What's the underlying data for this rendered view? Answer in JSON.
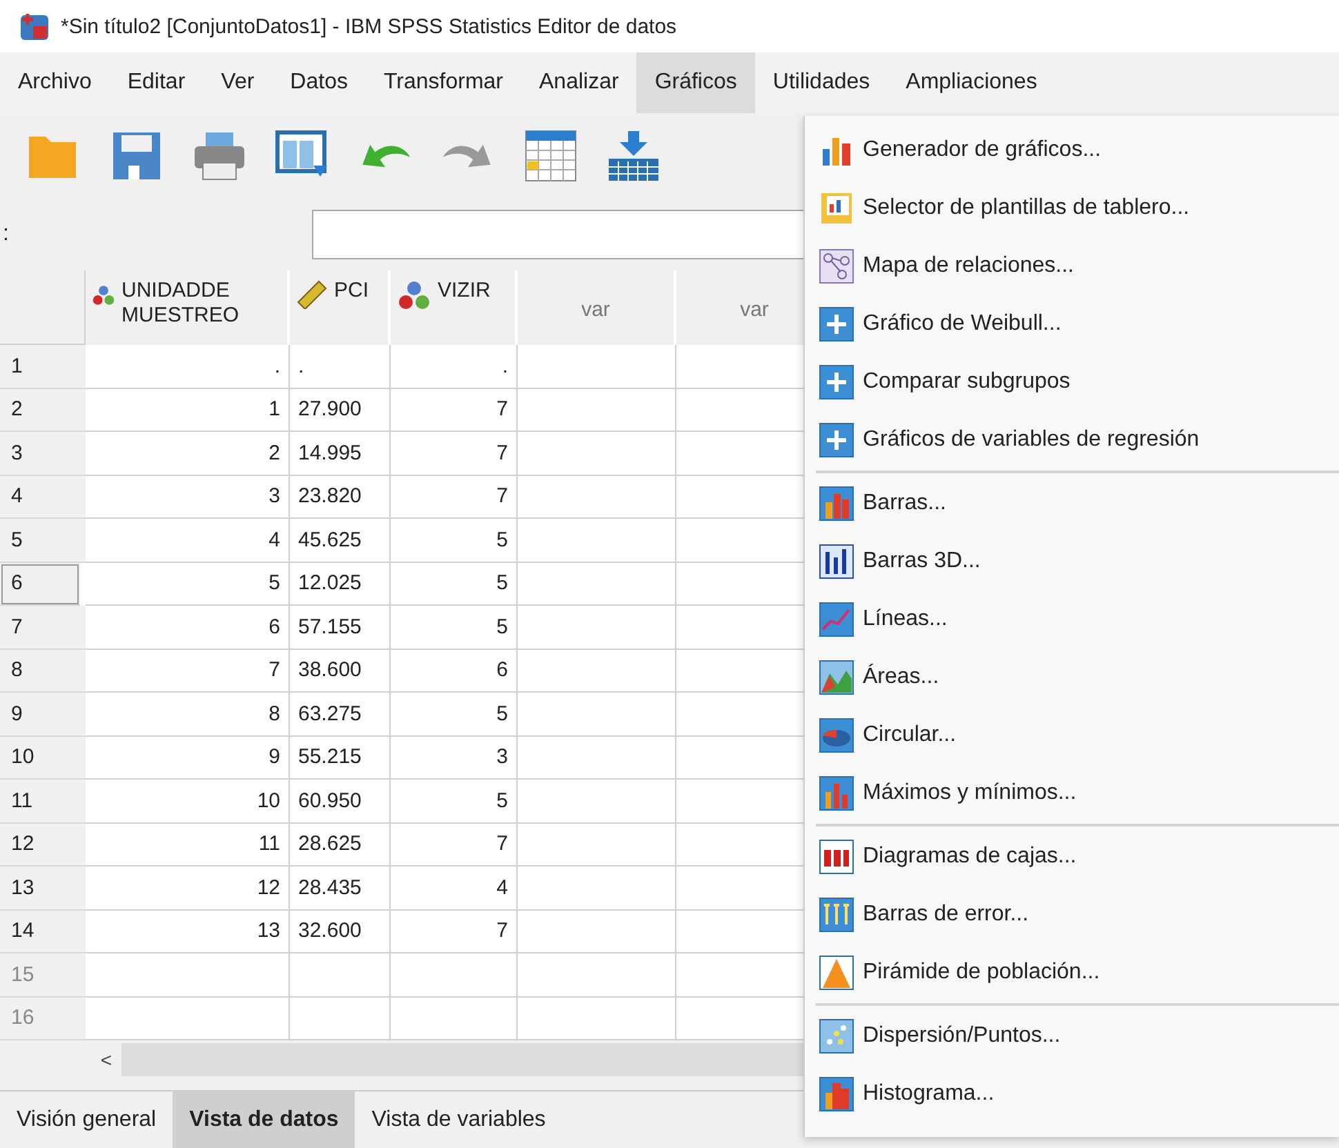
{
  "window": {
    "title": "*Sin título2 [ConjuntoDatos1] - IBM SPSS Statistics Editor de datos"
  },
  "menu_bar": [
    {
      "label": "Archivo",
      "selected": false
    },
    {
      "label": "Editar",
      "selected": false
    },
    {
      "label": "Ver",
      "selected": false
    },
    {
      "label": "Datos",
      "selected": false
    },
    {
      "label": "Transformar",
      "selected": false
    },
    {
      "label": "Analizar",
      "selected": false
    },
    {
      "label": "Gráficos",
      "selected": true
    },
    {
      "label": "Utilidades",
      "selected": false
    },
    {
      "label": "Ampliaciones",
      "selected": false
    }
  ],
  "cell_editor": {
    "label": ":"
  },
  "grid": {
    "columns": [
      {
        "name": "UNIDADDE MUESTREO",
        "kind": "nominal"
      },
      {
        "name": "PCI",
        "kind": "scale"
      },
      {
        "name": "VIZIR",
        "kind": "nominal"
      },
      {
        "name": "var",
        "kind": "empty"
      },
      {
        "name": "var",
        "kind": "empty"
      }
    ],
    "rows": [
      {
        "number": "1",
        "has_data": true,
        "selected": false,
        "cells": [
          ".",
          ".",
          "."
        ]
      },
      {
        "number": "2",
        "has_data": true,
        "selected": false,
        "cells": [
          "1",
          "27.900",
          "7"
        ]
      },
      {
        "number": "3",
        "has_data": true,
        "selected": false,
        "cells": [
          "2",
          "14.995",
          "7"
        ]
      },
      {
        "number": "4",
        "has_data": true,
        "selected": false,
        "cells": [
          "3",
          "23.820",
          "7"
        ]
      },
      {
        "number": "5",
        "has_data": true,
        "selected": false,
        "cells": [
          "4",
          "45.625",
          "5"
        ]
      },
      {
        "number": "6",
        "has_data": true,
        "selected": true,
        "cells": [
          "5",
          "12.025",
          "5"
        ]
      },
      {
        "number": "7",
        "has_data": true,
        "selected": false,
        "cells": [
          "6",
          "57.155",
          "5"
        ]
      },
      {
        "number": "8",
        "has_data": true,
        "selected": false,
        "cells": [
          "7",
          "38.600",
          "6"
        ]
      },
      {
        "number": "9",
        "has_data": true,
        "selected": false,
        "cells": [
          "8",
          "63.275",
          "5"
        ]
      },
      {
        "number": "10",
        "has_data": true,
        "selected": false,
        "cells": [
          "9",
          "55.215",
          "3"
        ]
      },
      {
        "number": "11",
        "has_data": true,
        "selected": false,
        "cells": [
          "10",
          "60.950",
          "5"
        ]
      },
      {
        "number": "12",
        "has_data": true,
        "selected": false,
        "cells": [
          "11",
          "28.625",
          "7"
        ]
      },
      {
        "number": "13",
        "has_data": true,
        "selected": false,
        "cells": [
          "12",
          "28.435",
          "4"
        ]
      },
      {
        "number": "14",
        "has_data": true,
        "selected": false,
        "cells": [
          "13",
          "32.600",
          "7"
        ]
      },
      {
        "number": "15",
        "has_data": false,
        "selected": false,
        "cells": []
      },
      {
        "number": "16",
        "has_data": false,
        "selected": false,
        "cells": []
      }
    ]
  },
  "scroll_left": "<",
  "tabs": [
    {
      "label": "Visión general",
      "selected": false
    },
    {
      "label": "Vista de datos",
      "selected": true
    },
    {
      "label": "Vista de variables",
      "selected": false
    }
  ],
  "dropdown": {
    "groups": [
      [
        {
          "label": "Generador de gráficos..."
        },
        {
          "label": "Selector de plantillas de tablero..."
        },
        {
          "label": "Mapa de relaciones..."
        },
        {
          "label": "Gráfico de Weibull..."
        },
        {
          "label": "Comparar subgrupos"
        },
        {
          "label": "Gráficos de variables de regresión"
        }
      ],
      [
        {
          "label": "Barras..."
        },
        {
          "label": "Barras 3D..."
        },
        {
          "label": "Líneas..."
        },
        {
          "label": "Áreas..."
        },
        {
          "label": "Circular..."
        },
        {
          "label": "Máximos y mínimos..."
        }
      ],
      [
        {
          "label": "Diagramas de cajas..."
        },
        {
          "label": "Barras de error..."
        },
        {
          "label": "Pirámide de población..."
        }
      ],
      [
        {
          "label": "Dispersión/Puntos..."
        },
        {
          "label": "Histograma..."
        }
      ]
    ]
  }
}
